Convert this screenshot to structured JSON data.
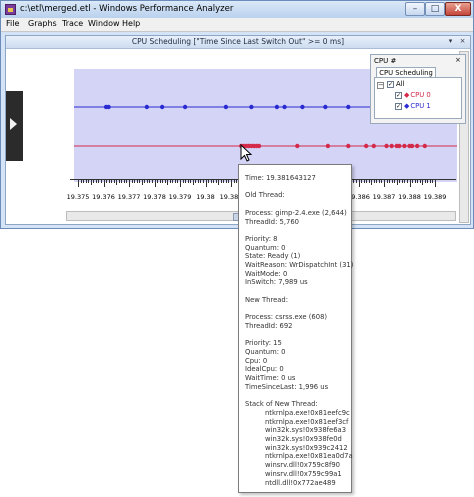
{
  "window": {
    "title": "c:\\etl\\merged.etl - Windows Performance Analyzer",
    "controls": {
      "minimize": "–",
      "maximize": "□",
      "close": "X"
    }
  },
  "menu": [
    "File",
    "Graphs",
    "Trace",
    "Window",
    "Help"
  ],
  "graph": {
    "title": "CPU Scheduling [\"Time Since Last Switch Out\" >= 0 ms]",
    "title_buttons": [
      "▾",
      "×"
    ],
    "x_ticks": [
      "19.375",
      "19.376",
      "19.377",
      "19.378",
      "19.379",
      "19.38",
      "19.381",
      "19.382",
      "19.383",
      "19.384",
      "19.385",
      "19.386",
      "19.387",
      "19.388",
      "19.389"
    ],
    "series": [
      {
        "name": "CPU 1",
        "color": "#2a2ad2",
        "times": [
          19.3761,
          19.3762,
          19.3777,
          19.3783,
          19.3792,
          19.3808,
          19.3818,
          19.3828,
          19.3831,
          19.3838,
          19.3847,
          19.3856,
          19.3867,
          19.3883
        ]
      },
      {
        "name": "CPU 0",
        "color": "#d42a4a",
        "times": [
          19.3814,
          19.3815,
          19.3816,
          19.3817,
          19.3818,
          19.3819,
          19.382,
          19.3821,
          19.3836,
          19.3848,
          19.3856,
          19.3863,
          19.3866,
          19.3871,
          19.3873,
          19.3875,
          19.3876,
          19.3878,
          19.388,
          19.3881,
          19.3883,
          19.3886
        ]
      }
    ]
  },
  "cpu_panel": {
    "title": "CPU #",
    "close": "×",
    "tab": "CPU Scheduling",
    "tree": {
      "expander": "−",
      "root": "All",
      "items": [
        {
          "label": "CPU 0",
          "color": "#d42a4a",
          "symbol": "◆"
        },
        {
          "label": "CPU 1",
          "color": "#2a2ad2",
          "symbol": "◆"
        }
      ]
    }
  },
  "tooltip": {
    "lines": [
      {
        "text": "Time: 19.381643127",
        "indent": false
      },
      {
        "text": "",
        "indent": false
      },
      {
        "text": "Old Thread:",
        "indent": false
      },
      {
        "text": "",
        "indent": false
      },
      {
        "text": "Process: gimp-2.4.exe (2,644)",
        "indent": false
      },
      {
        "text": "ThreadId: 5,760",
        "indent": false
      },
      {
        "text": "",
        "indent": false
      },
      {
        "text": "Priority: 8",
        "indent": false
      },
      {
        "text": "Quantum: 0",
        "indent": false
      },
      {
        "text": "State: Ready (1)",
        "indent": false
      },
      {
        "text": "WaitReason: WrDispatchInt (31)",
        "indent": false
      },
      {
        "text": "WaitMode: 0",
        "indent": false
      },
      {
        "text": "InSwitch: 7,989 us",
        "indent": false
      },
      {
        "text": "",
        "indent": false
      },
      {
        "text": "New Thread:",
        "indent": false
      },
      {
        "text": "",
        "indent": false
      },
      {
        "text": "Process: csrss.exe (608)",
        "indent": false
      },
      {
        "text": "ThreadId: 692",
        "indent": false
      },
      {
        "text": "",
        "indent": false
      },
      {
        "text": "Priority: 15",
        "indent": false
      },
      {
        "text": "Quantum: 0",
        "indent": false
      },
      {
        "text": "Cpu: 0",
        "indent": false
      },
      {
        "text": "IdealCpu: 0",
        "indent": false
      },
      {
        "text": "WaitTime: 0 us",
        "indent": false
      },
      {
        "text": "TimeSinceLast: 1,996 us",
        "indent": false
      },
      {
        "text": "",
        "indent": false
      },
      {
        "text": "Stack of New Thread:",
        "indent": false
      },
      {
        "text": "ntkrnlpa.exe!0x81eefc9c",
        "indent": true
      },
      {
        "text": "ntkrnlpa.exe!0x81eef3cf",
        "indent": true
      },
      {
        "text": "win32k.sys!0x938fe6a3",
        "indent": true
      },
      {
        "text": "win32k.sys!0x938fe0d",
        "indent": true
      },
      {
        "text": "win32k.sys!0x939c2412",
        "indent": true
      },
      {
        "text": "ntkrnlpa.exe!0x81ea0d7a",
        "indent": true
      },
      {
        "text": "winsrv.dll!0x759c8f90",
        "indent": true
      },
      {
        "text": "winsrv.dll!0x759c99a1",
        "indent": true
      },
      {
        "text": "ntdll.dll!0x772ae489",
        "indent": true
      }
    ]
  }
}
